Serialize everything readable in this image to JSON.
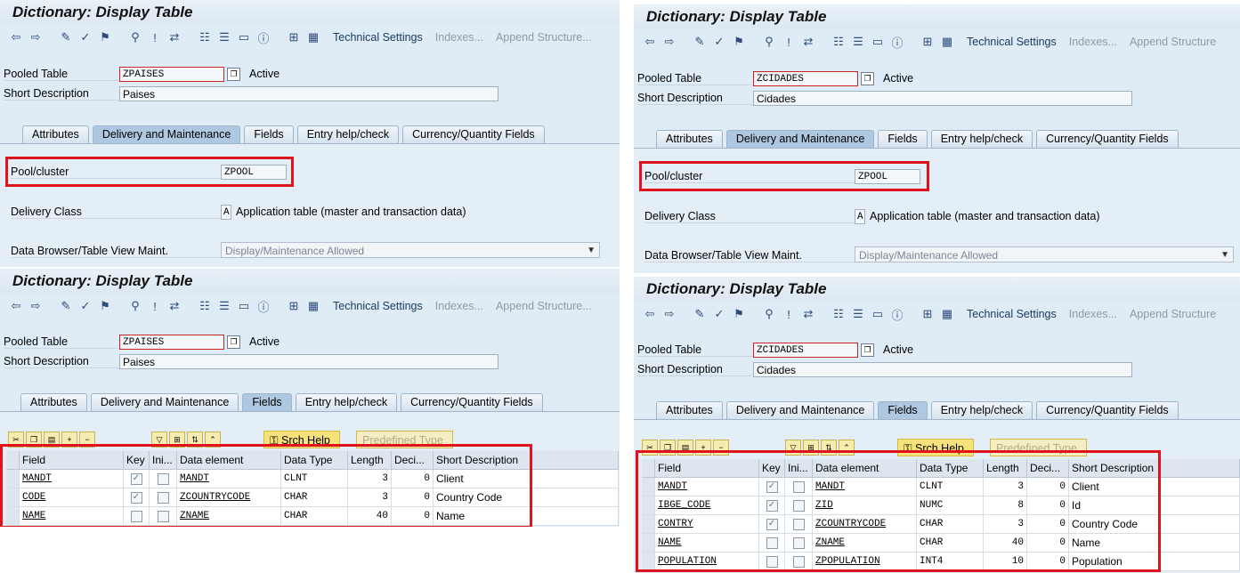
{
  "panels": [
    {
      "title": "Dictionary: Display Table",
      "toolbar": {
        "tech": "Technical Settings",
        "indexes": "Indexes...",
        "append": "Append Structure..."
      },
      "table_type_label": "Pooled Table",
      "table_name": "ZPAISES",
      "status": "Active",
      "short_desc_label": "Short Description",
      "short_desc": "Paises",
      "tabs": [
        "Attributes",
        "Delivery and Maintenance",
        "Fields",
        "Entry help/check",
        "Currency/Quantity Fields"
      ],
      "pool_label": "Pool/cluster",
      "pool_value": "ZPOOL",
      "delivery_label": "Delivery Class",
      "delivery_code": "A",
      "delivery_text": "Application table (master and transaction data)",
      "browser_label": "Data Browser/Table View Maint.",
      "browser_value": "Display/Maintenance Allowed"
    },
    {
      "title": "Dictionary: Display Table",
      "toolbar": {
        "tech": "Technical Settings",
        "indexes": "Indexes...",
        "append": "Append Structure"
      },
      "table_type_label": "Pooled Table",
      "table_name": "ZCIDADES",
      "status": "Active",
      "short_desc_label": "Short Description",
      "short_desc": "Cidades",
      "tabs": [
        "Attributes",
        "Delivery and Maintenance",
        "Fields",
        "Entry help/check",
        "Currency/Quantity Fields"
      ],
      "pool_label": "Pool/cluster",
      "pool_value": "ZPOOL",
      "delivery_label": "Delivery Class",
      "delivery_code": "A",
      "delivery_text": "Application table (master and transaction data)",
      "browser_label": "Data Browser/Table View Maint.",
      "browser_value": "Display/Maintenance Allowed"
    },
    {
      "title": "Dictionary: Display Table",
      "toolbar": {
        "tech": "Technical Settings",
        "indexes": "Indexes...",
        "append": "Append Structure..."
      },
      "table_type_label": "Pooled Table",
      "table_name": "ZPAISES",
      "status": "Active",
      "short_desc_label": "Short Description",
      "short_desc": "Paises",
      "tabs": [
        "Attributes",
        "Delivery and Maintenance",
        "Fields",
        "Entry help/check",
        "Currency/Quantity Fields"
      ],
      "srch_help": "Srch Help",
      "predef": "Predefined Type",
      "columns": [
        "Field",
        "Key",
        "Ini...",
        "Data element",
        "Data Type",
        "Length",
        "Deci...",
        "Short Description"
      ],
      "rows": [
        {
          "field": "MANDT",
          "key": true,
          "ini": false,
          "element": "MANDT",
          "type": "CLNT",
          "length": "3",
          "dec": "0",
          "desc": "Client"
        },
        {
          "field": "CODE",
          "key": true,
          "ini": false,
          "element": "ZCOUNTRYCODE",
          "type": "CHAR",
          "length": "3",
          "dec": "0",
          "desc": "Country Code"
        },
        {
          "field": "NAME",
          "key": false,
          "ini": false,
          "element": "ZNAME",
          "type": "CHAR",
          "length": "40",
          "dec": "0",
          "desc": "Name"
        }
      ]
    },
    {
      "title": "Dictionary: Display Table",
      "toolbar": {
        "tech": "Technical Settings",
        "indexes": "Indexes...",
        "append": "Append Structure"
      },
      "table_type_label": "Pooled Table",
      "table_name": "ZCIDADES",
      "status": "Active",
      "short_desc_label": "Short Description",
      "short_desc": "Cidades",
      "tabs": [
        "Attributes",
        "Delivery and Maintenance",
        "Fields",
        "Entry help/check",
        "Currency/Quantity Fields"
      ],
      "srch_help": "Srch Help",
      "predef": "Predefined Type",
      "columns": [
        "Field",
        "Key",
        "Ini...",
        "Data element",
        "Data Type",
        "Length",
        "Deci...",
        "Short Description"
      ],
      "rows": [
        {
          "field": "MANDT",
          "key": true,
          "ini": false,
          "element": "MANDT",
          "type": "CLNT",
          "length": "3",
          "dec": "0",
          "desc": "Client"
        },
        {
          "field": "IBGE_CODE",
          "key": true,
          "ini": false,
          "element": "ZID",
          "type": "NUMC",
          "length": "8",
          "dec": "0",
          "desc": "Id"
        },
        {
          "field": "CONTRY",
          "key": true,
          "ini": false,
          "element": "ZCOUNTRYCODE",
          "type": "CHAR",
          "length": "3",
          "dec": "0",
          "desc": "Country Code"
        },
        {
          "field": "NAME",
          "key": false,
          "ini": false,
          "element": "ZNAME",
          "type": "CHAR",
          "length": "40",
          "dec": "0",
          "desc": "Name"
        },
        {
          "field": "POPULATION",
          "key": false,
          "ini": false,
          "element": "ZPOPULATION",
          "type": "INT4",
          "length": "10",
          "dec": "0",
          "desc": "Population"
        }
      ]
    }
  ]
}
